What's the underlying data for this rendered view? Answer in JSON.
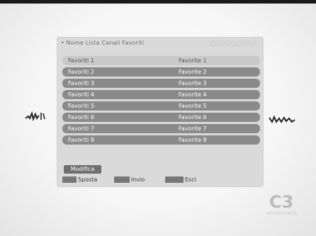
{
  "menu": {
    "header": "• Nome  Lista  Canali  Favoriti",
    "rows": [
      {
        "name": "Favoriti 1",
        "value": "Favorite 1"
      },
      {
        "name": "Favoriti 2",
        "value": "Favorite 2"
      },
      {
        "name": "Favoriti 3",
        "value": "Favorite 3"
      },
      {
        "name": "Favoriti 4",
        "value": "Favorite 4"
      },
      {
        "name": "Favoriti 5",
        "value": "Favorite 5"
      },
      {
        "name": "Favoriti 6",
        "value": "Favorite 6"
      },
      {
        "name": "Favoriti 7",
        "value": "Favorite 7"
      },
      {
        "name": "Favoriti 8",
        "value": "Favorite 8"
      }
    ],
    "modifica_label": "Modifica"
  },
  "hints": {
    "move_label": "Sposta",
    "ok_label": "Invio",
    "exit_label": "Esci"
  },
  "branding": {
    "logo_glyph": "C3",
    "logo_sub": "AVVERTENZE"
  },
  "colors": {
    "selected_row": "#c9c9c9",
    "row": "#8a8a8a",
    "button": "#6f6f6f"
  },
  "icons": {
    "move": "arrow-keys-icon",
    "ok": "ok-key-icon",
    "exit": "exit-key-icon"
  },
  "selected_index": 0
}
